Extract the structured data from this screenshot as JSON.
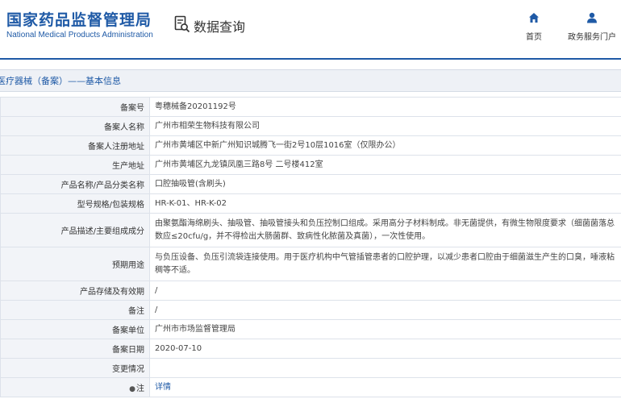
{
  "header": {
    "logo_cn": "国家药品监督管理局",
    "logo_en": "National Medical Products Administration",
    "query_title": "数据查询",
    "nav": [
      {
        "label": "首页",
        "icon": "home-icon"
      },
      {
        "label": "政务服务门户",
        "icon": "user-icon"
      }
    ]
  },
  "colors": {
    "brand": "#1f5aa6",
    "label_bg": "#f2f4f8",
    "border": "#dde2ea"
  },
  "section": {
    "title": "医疗器械（备案）——基本信息"
  },
  "rows": [
    {
      "label": "备案号",
      "value": "粤穗械备20201192号"
    },
    {
      "label": "备案人名称",
      "value": "广州市相荣生物科技有限公司"
    },
    {
      "label": "备案人注册地址",
      "value": "广州市黄埔区中新广州知识城腾飞一街2号10层1016室（仅限办公）"
    },
    {
      "label": "生产地址",
      "value": "广州市黄埔区九龙镇凤凰三路8号 二号楼412室"
    },
    {
      "label": "产品名称/产品分类名称",
      "value": "口腔抽吸管(含刷头)"
    },
    {
      "label": "型号规格/包装规格",
      "value": "HR-K-01、HR-K-02"
    },
    {
      "label": "产品描述/主要组成成分",
      "value": "由聚氨酯海绵刷头、抽吸管、抽吸管接头和负压控制口组成。采用高分子材料制成。非无菌提供，有微生物限度要求（细菌菌落总数应≤20cfu/g，并不得检出大肠菌群、致病性化脓菌及真菌），一次性使用。"
    },
    {
      "label": "预期用途",
      "value": "与负压设备、负压引流袋连接使用。用于医疗机构中气管插管患者的口腔护理，以减少患者口腔由于细菌滋生产生的口臭，唾液粘稠等不适。"
    },
    {
      "label": "产品存储及有效期",
      "value": "/"
    },
    {
      "label": "备注",
      "value": "/"
    },
    {
      "label": "备案单位",
      "value": "广州市市场监督管理局"
    },
    {
      "label": "备案日期",
      "value": "2020-07-10"
    },
    {
      "label": "变更情况",
      "value": ""
    },
    {
      "label": "注",
      "value": "详情",
      "pin": "●"
    }
  ]
}
